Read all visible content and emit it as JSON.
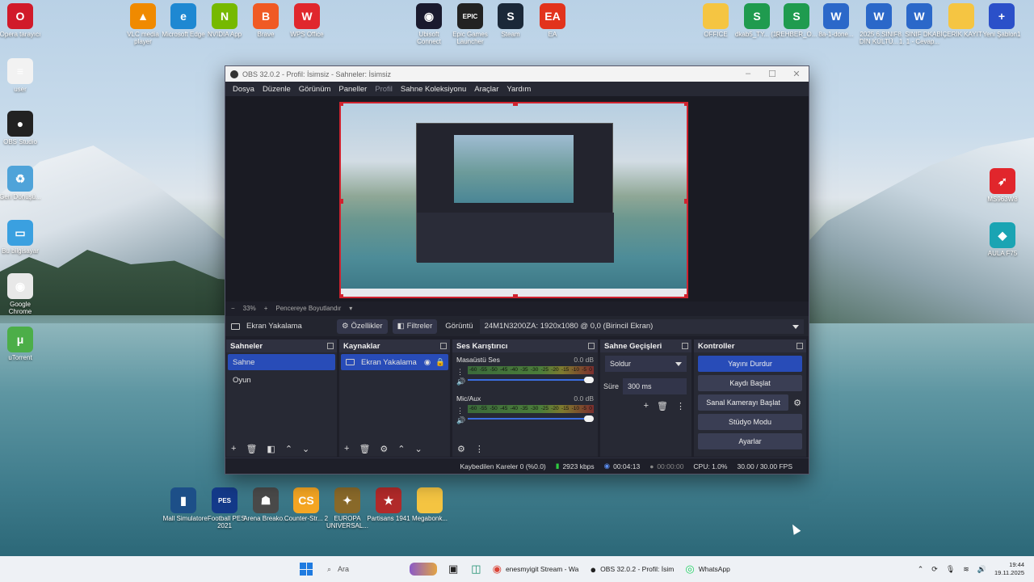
{
  "desktop": {
    "icons_top": [
      {
        "label": "Opera tarayıcı",
        "color": "#d11a2a",
        "glyph": "O"
      },
      {
        "label": "VLC media player",
        "color": "#f08a00",
        "glyph": "▲"
      },
      {
        "label": "Microsoft Edge",
        "color": "#1e88d2",
        "glyph": "e"
      },
      {
        "label": "NVIDIA App",
        "color": "#76b900",
        "glyph": "N"
      },
      {
        "label": "Brave",
        "color": "#f05a24",
        "glyph": "B"
      },
      {
        "label": "WPS Office",
        "color": "#e0272d",
        "glyph": "W"
      },
      {
        "label": "Ubisoft Connect",
        "color": "#1a1a2e",
        "glyph": "◉"
      },
      {
        "label": "Epic Games Launcher",
        "color": "#222",
        "glyph": "EPIC"
      },
      {
        "label": "Steam",
        "color": "#1b2838",
        "glyph": "S"
      },
      {
        "label": "EA",
        "color": "#e2331c",
        "glyph": "EA"
      },
      {
        "label": "OFFICE",
        "color": "#f5c542",
        "glyph": ""
      },
      {
        "label": "dkab5_TY... (1)",
        "color": "#1f9b4f",
        "glyph": "S"
      },
      {
        "label": "REHBER_O...",
        "color": "#1f9b4f",
        "glyph": "S"
      },
      {
        "label": "8a-1-done...",
        "color": "#2b68c9",
        "glyph": "W"
      },
      {
        "label": "2025 6.SINIF DİN KÜLTÜ...",
        "color": "#2b68c9",
        "glyph": "W"
      },
      {
        "label": "8. SINIF DKAB 1. 1 - Cevap...",
        "color": "#2b68c9",
        "glyph": "W"
      },
      {
        "label": "İÇERİK KAYIT",
        "color": "#f5c542",
        "glyph": ""
      },
      {
        "label": "Yeni Şablon1",
        "color": "#2b50c9",
        "glyph": "+"
      }
    ],
    "icons_left": [
      {
        "label": "user",
        "color": "#f2f2f2",
        "glyph": "≡"
      },
      {
        "label": "OBS Studio",
        "color": "#222",
        "glyph": "●"
      },
      {
        "label": "Geri Dönüşü...",
        "color": "#4fa3d9",
        "glyph": "♻"
      },
      {
        "label": "Bu bilgisayar",
        "color": "#3aa0e0",
        "glyph": "▭"
      },
      {
        "label": "Google Chrome",
        "color": "#e8e8e8",
        "glyph": "◉"
      },
      {
        "label": "uTorrent",
        "color": "#4cae48",
        "glyph": "μ"
      }
    ],
    "icons_right": [
      {
        "label": "MS963W8",
        "color": "#e1262c",
        "glyph": "➶"
      },
      {
        "label": "AULA F75",
        "color": "#1aa4b3",
        "glyph": "◆"
      }
    ],
    "icons_bottom": [
      {
        "label": "Mall Simulator",
        "color": "#1d4f88",
        "glyph": "▮"
      },
      {
        "label": "eFootball PES 2021",
        "color": "#143a8a",
        "glyph": "PES"
      },
      {
        "label": "Arena Breako...",
        "color": "#4a4a4a",
        "glyph": "☗"
      },
      {
        "label": "Counter-Str... 2",
        "color": "#f5a623",
        "glyph": "CS"
      },
      {
        "label": "EUROPA UNIVERSAL...",
        "color": "#8a6a2a",
        "glyph": "✦"
      },
      {
        "label": "Partisans 1941",
        "color": "#b22a2a",
        "glyph": "★"
      },
      {
        "label": "Megabonk...",
        "color": "#f5c542",
        "glyph": ""
      }
    ]
  },
  "obs": {
    "title": "OBS 32.0.2 - Profil: İsimsiz - Sahneler: İsimsiz",
    "menu": [
      "Dosya",
      "Düzenle",
      "Görünüm",
      "Paneller",
      "Profil",
      "Sahne Koleksiyonu",
      "Araçlar",
      "Yardım"
    ],
    "zoom": "33%",
    "fit_label": "Pencereye Boyutlandır",
    "source_bar": {
      "name": "Ekran Yakalama",
      "properties": "Özellikler",
      "filters": "Filtreler",
      "display_label": "Görüntü",
      "display_value": "24M1N3200ZA: 1920x1080 @ 0,0 (Birincil Ekran)"
    },
    "scenes": {
      "title": "Sahneler",
      "items": [
        "Sahne",
        "Oyun"
      ]
    },
    "sources": {
      "title": "Kaynaklar",
      "items": [
        "Ekran Yakalama"
      ]
    },
    "mixer": {
      "title": "Ses Karıştırıcı",
      "channels": [
        {
          "name": "Masaüstü Ses",
          "db": "0.0 dB"
        },
        {
          "name": "Mic/Aux",
          "db": "0.0 dB"
        }
      ],
      "scale": [
        "-60",
        "-55",
        "-50",
        "-45",
        "-40",
        "-35",
        "-30",
        "-25",
        "-20",
        "-15",
        "-10",
        "-5",
        "0"
      ]
    },
    "transitions": {
      "title": "Sahne Geçişleri",
      "type": "Soldur",
      "duration_label": "Süre",
      "duration": "300 ms"
    },
    "controls": {
      "title": "Kontroller",
      "buttons": [
        "Yayını Durdur",
        "Kaydı Başlat",
        "Sanal Kamerayı Başlat",
        "Stüdyo Modu",
        "Ayarlar"
      ]
    },
    "status": {
      "dropped": "Kaybedilen Kareler 0 (%0.0)",
      "bitrate": "2923 kbps",
      "stream_time": "00:04:13",
      "rec_time": "00:00:00",
      "cpu": "CPU: 1.0%",
      "fps": "30.00 / 30.00 FPS"
    }
  },
  "taskbar": {
    "search": "Ara",
    "apps": [
      {
        "label": "enesmyigit Stream - Wa"
      },
      {
        "label": "OBS 32.0.2 - Profil: İsim"
      },
      {
        "label": "WhatsApp"
      }
    ],
    "time": "19:44",
    "date": "19.11.2025"
  }
}
